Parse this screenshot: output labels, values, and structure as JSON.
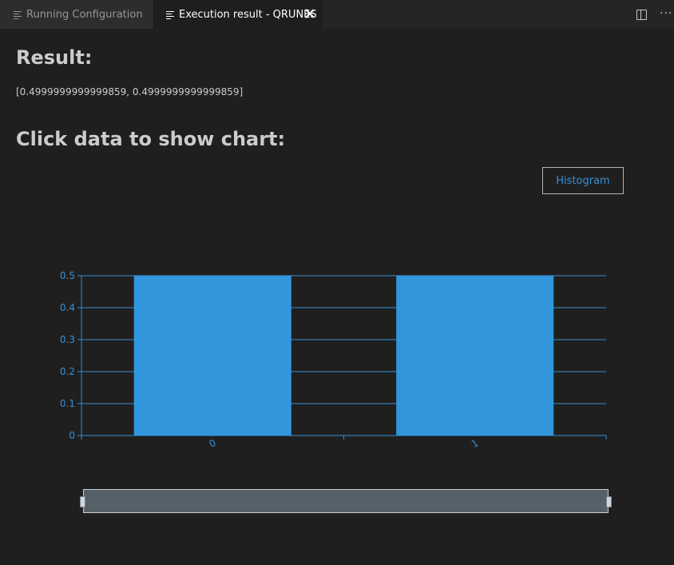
{
  "tabs": [
    {
      "label": "Running Configuration",
      "active": false,
      "icon": "preview-icon"
    },
    {
      "label": "Execution result - QRUNES",
      "active": true,
      "icon": "preview-icon"
    }
  ],
  "page": {
    "result_heading": "Result:",
    "result_value": "[0.4999999999999859, 0.4999999999999859]",
    "chart_heading": "Click data to show chart:",
    "histogram_button": "Histogram"
  },
  "colors": {
    "accent": "#3a8fd6",
    "bar": "#3296dc",
    "background": "#1f1f1f"
  },
  "chart_data": {
    "type": "bar",
    "categories": [
      "0",
      "1"
    ],
    "values": [
      0.4999999999999859,
      0.4999999999999859
    ],
    "title": "",
    "xlabel": "",
    "ylabel": "",
    "ylim": [
      0,
      0.5
    ],
    "yticks": [
      "0",
      "0.1",
      "0.2",
      "0.3",
      "0.4",
      "0.5"
    ],
    "grid": true,
    "zoom_slider": true
  }
}
